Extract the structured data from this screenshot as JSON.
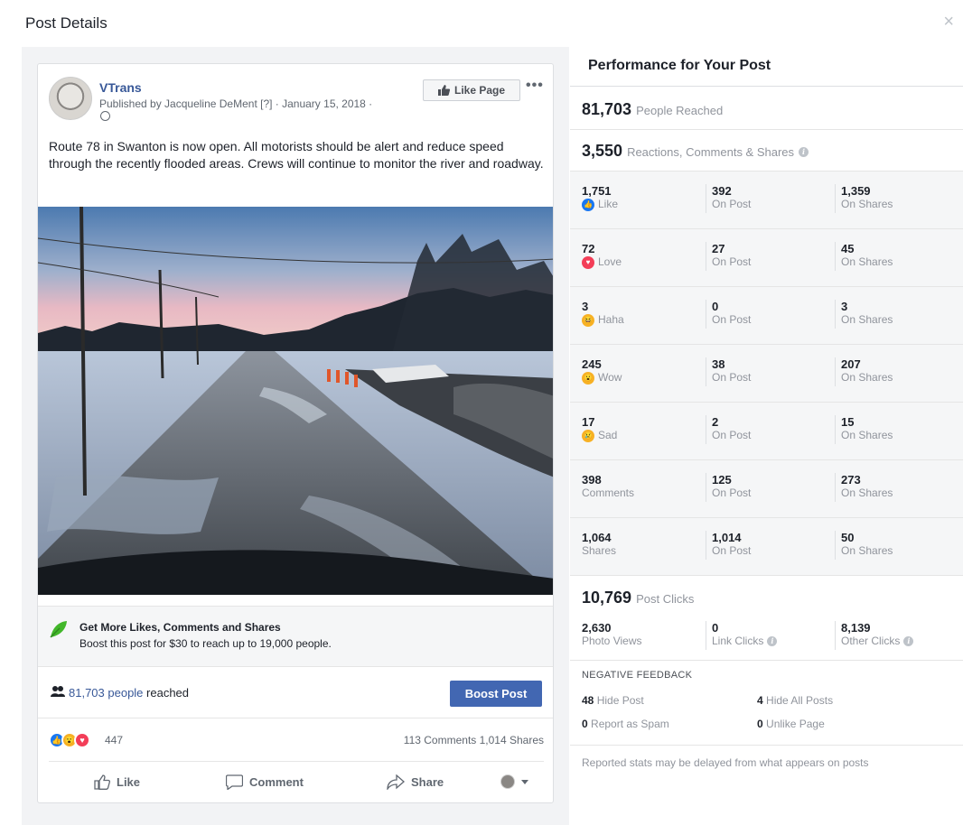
{
  "dialog": {
    "title": "Post Details",
    "close_glyph": "×"
  },
  "post": {
    "page_name": "VTrans",
    "published_by": "Published by Jacqueline DeMent [?] · January 15, 2018 ·",
    "like_page_label": "Like Page",
    "more_glyph": "•••",
    "text": "Route 78 in Swanton is now open. All motorists should be alert and reduce speed through the recently flooded areas. Crews will continue to monitor the river and roadway.",
    "boost_promo": {
      "title": "Get More Likes, Comments and Shares",
      "subtitle": "Boost this post for $30 to reach up to 19,000 people."
    },
    "reach_link": "81,703 people",
    "reach_suffix": " reached",
    "boost_button": "Boost Post",
    "reaction_count": "447",
    "comment_share_counts": "113 Comments  1,014 Shares",
    "actions": {
      "like": "Like",
      "comment": "Comment",
      "share": "Share"
    }
  },
  "performance": {
    "title": "Performance for Your Post",
    "people_reached": {
      "value": "81,703",
      "label": "People Reached"
    },
    "engagement": {
      "value": "3,550",
      "label": "Reactions, Comments & Shares"
    },
    "breakdown": [
      {
        "total": "1,751",
        "label": "Like",
        "on_post": "392",
        "on_post_label": "On Post",
        "on_shares": "1,359",
        "on_shares_label": "On Shares",
        "icon": "like-icon",
        "color": "#1877f2"
      },
      {
        "total": "72",
        "label": "Love",
        "on_post": "27",
        "on_post_label": "On Post",
        "on_shares": "45",
        "on_shares_label": "On Shares",
        "icon": "love-icon",
        "color": "#f33e58"
      },
      {
        "total": "3",
        "label": "Haha",
        "on_post": "0",
        "on_post_label": "On Post",
        "on_shares": "3",
        "on_shares_label": "On Shares",
        "icon": "haha-icon",
        "color": "#f7b125"
      },
      {
        "total": "245",
        "label": "Wow",
        "on_post": "38",
        "on_post_label": "On Post",
        "on_shares": "207",
        "on_shares_label": "On Shares",
        "icon": "wow-icon",
        "color": "#f7b125"
      },
      {
        "total": "17",
        "label": "Sad",
        "on_post": "2",
        "on_post_label": "On Post",
        "on_shares": "15",
        "on_shares_label": "On Shares",
        "icon": "sad-icon",
        "color": "#f7b125"
      },
      {
        "total": "398",
        "label": "Comments",
        "on_post": "125",
        "on_post_label": "On Post",
        "on_shares": "273",
        "on_shares_label": "On Shares",
        "icon": "",
        "color": ""
      },
      {
        "total": "1,064",
        "label": "Shares",
        "on_post": "1,014",
        "on_post_label": "On Post",
        "on_shares": "50",
        "on_shares_label": "On Shares",
        "icon": "",
        "color": ""
      }
    ],
    "post_clicks": {
      "value": "10,769",
      "label": "Post Clicks"
    },
    "clicks": [
      {
        "value": "2,630",
        "label": "Photo Views"
      },
      {
        "value": "0",
        "label": "Link Clicks"
      },
      {
        "value": "8,139",
        "label": "Other Clicks"
      }
    ],
    "negative_feedback": {
      "title": "NEGATIVE FEEDBACK",
      "hide_post": {
        "value": "48",
        "label": "Hide Post"
      },
      "hide_all_posts": {
        "value": "4",
        "label": "Hide All Posts"
      },
      "report_spam": {
        "value": "0",
        "label": "Report as Spam"
      },
      "unlike_page": {
        "value": "0",
        "label": "Unlike Page"
      }
    },
    "footer_note": "Reported stats may be delayed from what appears on posts"
  },
  "colors": {
    "link_blue": "#385898",
    "button_blue": "#4267b2",
    "muted_gray": "#90949c"
  }
}
